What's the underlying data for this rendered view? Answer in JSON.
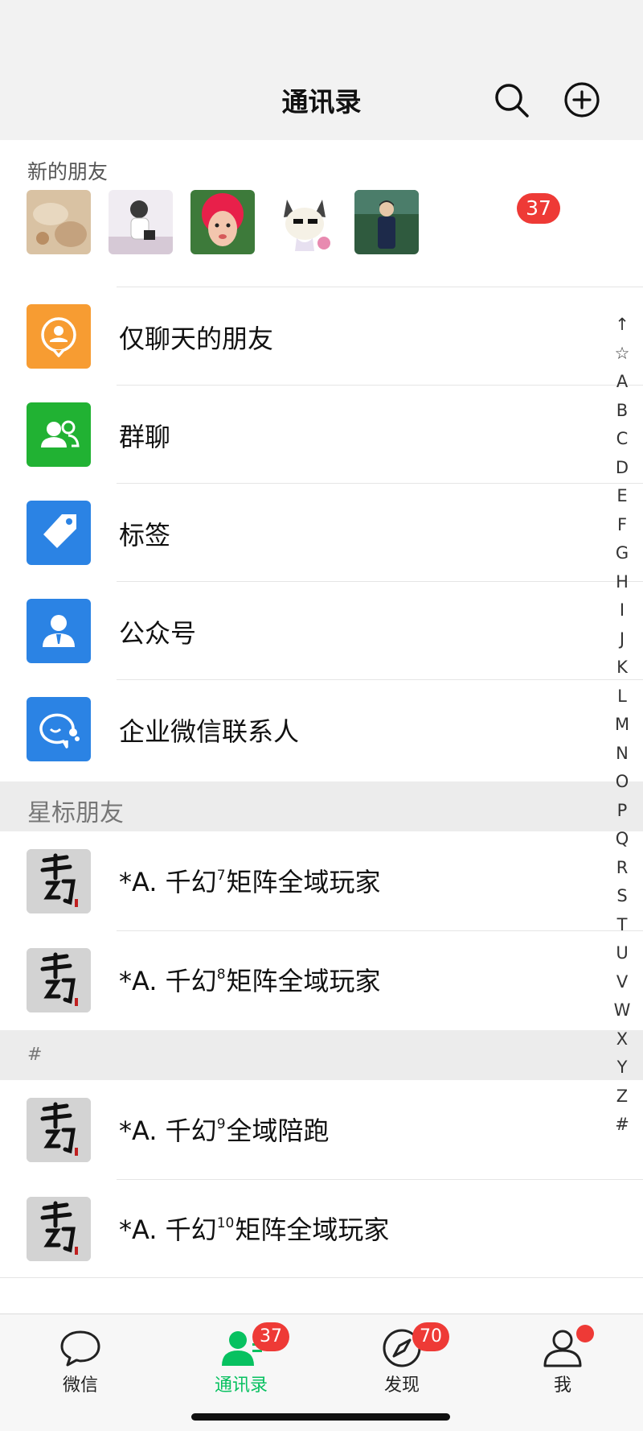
{
  "header": {
    "title": "通讯录"
  },
  "new_friends": {
    "label": "新的朋友",
    "badge": "37"
  },
  "menu": [
    {
      "label": "仅聊天的朋友",
      "icon": "chat-only-friends-icon",
      "color": "#f79c32"
    },
    {
      "label": "群聊",
      "icon": "group-chat-icon",
      "color": "#21b233"
    },
    {
      "label": "标签",
      "icon": "tag-icon",
      "color": "#2b83e4"
    },
    {
      "label": "公众号",
      "icon": "official-account-icon",
      "color": "#2b83e4"
    },
    {
      "label": "企业微信联系人",
      "icon": "work-contacts-icon",
      "color": "#2b83e4"
    }
  ],
  "sections": [
    {
      "title": "星标朋友"
    },
    {
      "title": "#"
    }
  ],
  "contacts": [
    {
      "prefix": "*A. 千幻",
      "sup": "7",
      "suffix": "矩阵全域玩家"
    },
    {
      "prefix": "*A. 千幻",
      "sup": "8",
      "suffix": "矩阵全域玩家"
    },
    {
      "prefix": "*A. 千幻",
      "sup": "9",
      "suffix": "全域陪跑"
    },
    {
      "prefix": "*A. 千幻",
      "sup": "10",
      "suffix": "矩阵全域玩家"
    }
  ],
  "index": [
    "↑",
    "☆",
    "A",
    "B",
    "C",
    "D",
    "E",
    "F",
    "G",
    "H",
    "I",
    "J",
    "K",
    "L",
    "M",
    "N",
    "O",
    "P",
    "Q",
    "R",
    "S",
    "T",
    "U",
    "V",
    "W",
    "X",
    "Y",
    "Z",
    "#"
  ],
  "tabs": [
    {
      "label": "微信",
      "icon": "chat-bubble-icon"
    },
    {
      "label": "通讯录",
      "icon": "contacts-icon",
      "badge": "37",
      "active": true
    },
    {
      "label": "发现",
      "icon": "compass-icon",
      "badge": "70"
    },
    {
      "label": "我",
      "icon": "profile-icon",
      "dot": true
    }
  ],
  "colors": {
    "accent": "#07c160",
    "badge": "#ee3a36"
  }
}
